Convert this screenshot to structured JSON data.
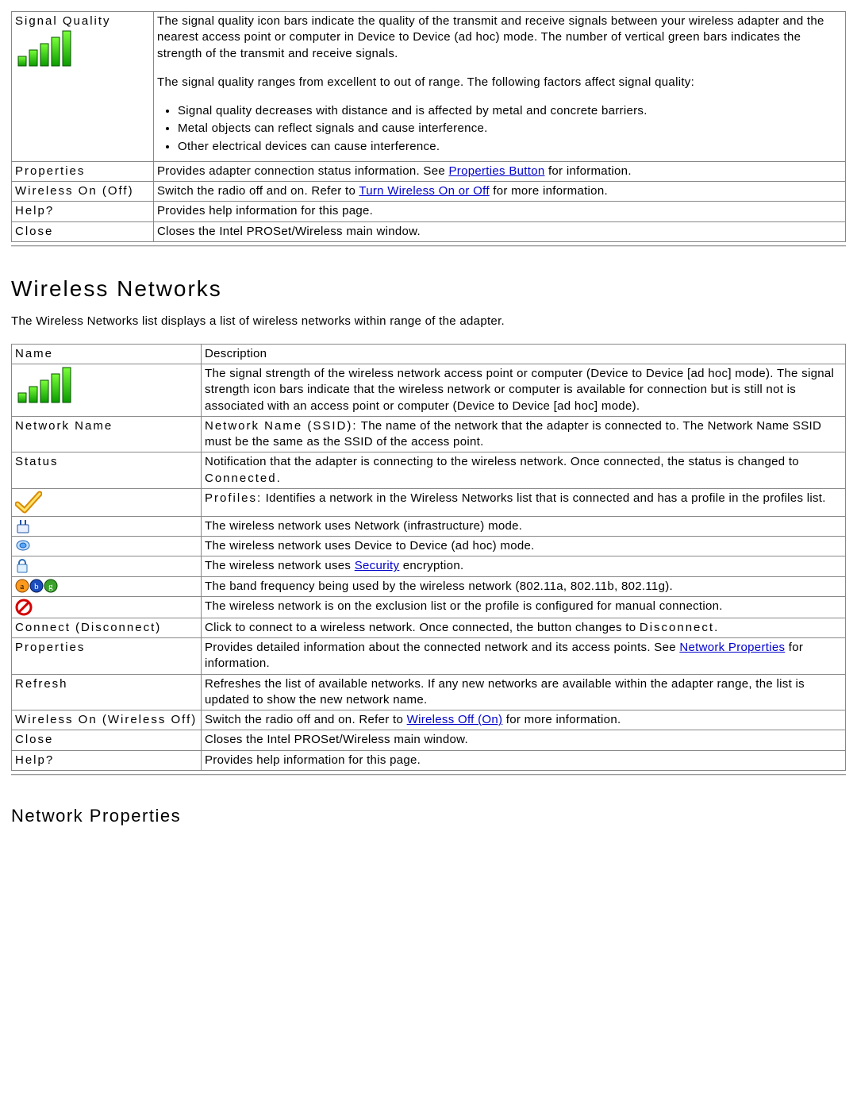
{
  "table1": [
    {
      "name": "Signal Quality",
      "icon": "signal-bars",
      "blocks": [
        {
          "t": "p",
          "v": "The signal quality icon bars indicate the quality of the transmit and receive signals between your wireless adapter and the nearest access point or computer in Device to Device (ad hoc) mode. The number of vertical green bars indicates the strength of the transmit and receive signals."
        },
        {
          "t": "p",
          "v": "The signal quality ranges from excellent to out of range. The following factors affect signal quality:"
        },
        {
          "t": "ul",
          "v": [
            "Signal quality decreases with distance and is affected by metal and concrete barriers.",
            "Metal objects can reflect signals and cause interference.",
            "Other electrical devices can cause interference."
          ]
        }
      ]
    },
    {
      "name": "Properties",
      "segments": [
        {
          "t": "text",
          "v": "Provides adapter connection status information. See "
        },
        {
          "t": "link",
          "v": "Properties Button"
        },
        {
          "t": "text",
          "v": " for information."
        }
      ]
    },
    {
      "name": "Wireless On (Off)",
      "segments": [
        {
          "t": "text",
          "v": "Switch the radio off and on. Refer to "
        },
        {
          "t": "link",
          "v": "Turn Wireless On or Off"
        },
        {
          "t": "text",
          "v": " for more information."
        }
      ]
    },
    {
      "name": "Help?",
      "segments": [
        {
          "t": "text",
          "v": "Provides help information for this page."
        }
      ]
    },
    {
      "name": "Close",
      "segments": [
        {
          "t": "text",
          "v": "Closes the Intel PROSet/Wireless main window."
        }
      ]
    }
  ],
  "section2_heading": "Wireless Networks",
  "section2_intro": "The Wireless Networks list displays a list of wireless networks within range of the adapter.",
  "table2": [
    {
      "name": "Name",
      "segments": [
        {
          "t": "text",
          "v": "Description"
        }
      ]
    },
    {
      "icon": "signal-bars",
      "segments": [
        {
          "t": "text",
          "v": "The signal strength of the wireless network access point or computer (Device to Device [ad hoc] mode). The signal strength icon bars indicate that the wireless network or computer is available for connection but is still not is associated with an access point or computer (Device to Device [ad hoc] mode)."
        }
      ]
    },
    {
      "name": "Network Name",
      "segments": [
        {
          "t": "span",
          "cls": "bold-run",
          "v": "Network Name (SSID):"
        },
        {
          "t": "text",
          "v": " The name of the network that the adapter is connected to. The Network Name SSID must be the same as the SSID of the access point."
        }
      ]
    },
    {
      "name": "Status",
      "segments": [
        {
          "t": "text",
          "v": "Notification that the adapter is connecting to the wireless network. Once connected, the status is changed to "
        },
        {
          "t": "span",
          "cls": "bold-run",
          "v": "Connected"
        },
        {
          "t": "text",
          "v": "."
        }
      ]
    },
    {
      "icon": "checkmark",
      "segments": [
        {
          "t": "span",
          "cls": "bold-run",
          "v": "Profiles:"
        },
        {
          "t": "text",
          "v": " Identifies a network in the Wireless Networks list that is connected and has a profile in the profiles list."
        }
      ]
    },
    {
      "icon": "infrastructure",
      "segments": [
        {
          "t": "text",
          "v": "The wireless network uses Network (infrastructure) mode."
        }
      ]
    },
    {
      "icon": "adhoc",
      "segments": [
        {
          "t": "text",
          "v": "The wireless network uses Device to Device (ad hoc) mode."
        }
      ]
    },
    {
      "icon": "lock",
      "segments": [
        {
          "t": "text",
          "v": "The wireless network uses "
        },
        {
          "t": "link",
          "v": "Security"
        },
        {
          "t": "text",
          "v": " encryption."
        }
      ]
    },
    {
      "icon": "bands",
      "segments": [
        {
          "t": "text",
          "v": "The band frequency being used by the wireless network (802.11a, 802.11b, 802.11g)."
        }
      ]
    },
    {
      "icon": "excluded",
      "segments": [
        {
          "t": "text",
          "v": "The wireless network is on the exclusion list or the profile is configured for manual connection."
        }
      ]
    },
    {
      "name": "Connect (Disconnect)",
      "segments": [
        {
          "t": "text",
          "v": "Click to connect to a wireless network. Once connected, the button changes to "
        },
        {
          "t": "span",
          "cls": "bold-run",
          "v": "Disconnect"
        },
        {
          "t": "text",
          "v": "."
        }
      ]
    },
    {
      "name": "Properties",
      "segments": [
        {
          "t": "text",
          "v": "Provides detailed information about the connected network and its access points. See "
        },
        {
          "t": "link",
          "v": "Network Properties"
        },
        {
          "t": "text",
          "v": " for information."
        }
      ]
    },
    {
      "name": "Refresh",
      "segments": [
        {
          "t": "text",
          "v": "Refreshes the list of available networks. If any new networks are available within the adapter range, the list is updated to show the new network name."
        }
      ]
    },
    {
      "name": "Wireless On (Wireless Off)",
      "segments": [
        {
          "t": "text",
          "v": "Switch the radio off and on. Refer to "
        },
        {
          "t": "link",
          "v": "Wireless Off (On)"
        },
        {
          "t": "text",
          "v": " for more information."
        }
      ]
    },
    {
      "name": "Close",
      "segments": [
        {
          "t": "text",
          "v": "Closes the Intel PROSet/Wireless main window."
        }
      ]
    },
    {
      "name": "Help?",
      "segments": [
        {
          "t": "text",
          "v": "Provides help information for this page."
        }
      ]
    }
  ],
  "section3_heading": "Network Properties"
}
